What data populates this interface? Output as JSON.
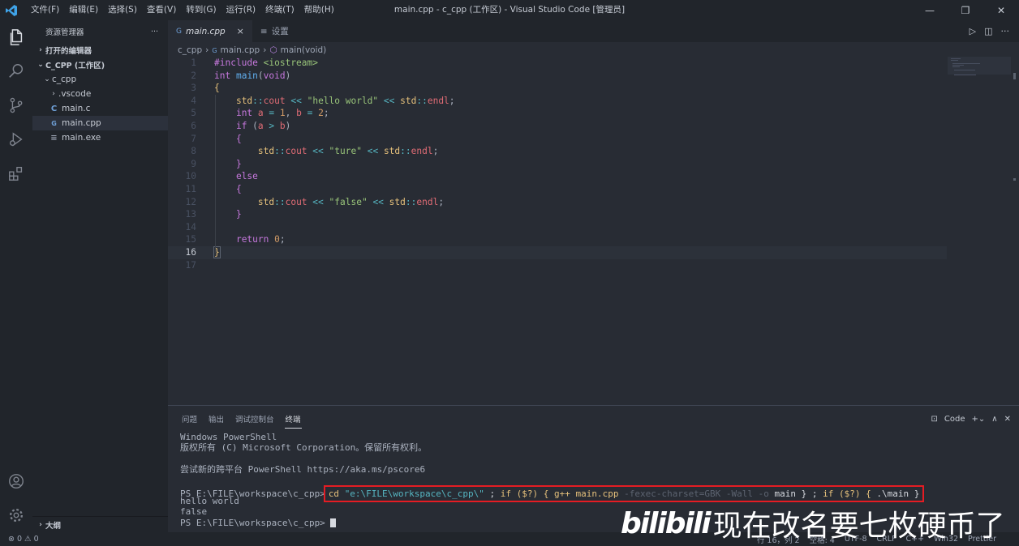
{
  "titlebar": {
    "title": "main.cpp - c_cpp (工作区) - Visual Studio Code [管理员]",
    "menu": [
      "文件(F)",
      "编辑(E)",
      "选择(S)",
      "查看(V)",
      "转到(G)",
      "运行(R)",
      "终端(T)",
      "帮助(H)"
    ]
  },
  "sidebar": {
    "header": "资源管理器",
    "more": "···",
    "open_editors": "打开的编辑器",
    "workspace": "C_CPP (工作区)",
    "folder": "c_cpp",
    "items": [
      {
        "label": ".vscode",
        "icon": "chevron-right"
      },
      {
        "label": "main.c",
        "icon": "C"
      },
      {
        "label": "main.cpp",
        "icon": "C++"
      },
      {
        "label": "main.exe",
        "icon": "file-lines"
      }
    ],
    "outline": "大纲"
  },
  "tabs": [
    {
      "label": "main.cpp",
      "close": "×"
    },
    {
      "label": "设置"
    }
  ],
  "breadcrumb": [
    "c_cpp",
    "main.cpp",
    "main(void)"
  ],
  "code": {
    "current_line": 16,
    "lines": [
      "#include <iostream>",
      "int main(void)",
      "{",
      "    std::cout << \"hello world\" << std::endl;",
      "    int a = 1, b = 2;",
      "    if (a > b)",
      "    {",
      "        std::cout << \"ture\" << std::endl;",
      "    }",
      "    else",
      "    {",
      "        std::cout << \"false\" << std::endl;",
      "    }",
      "",
      "    return 0;",
      "}",
      ""
    ]
  },
  "panel": {
    "tabs": [
      "问题",
      "输出",
      "调试控制台",
      "终端"
    ],
    "active_tab": "终端",
    "shell_label": "Code",
    "terminal": {
      "line1": "Windows PowerShell",
      "line2": "版权所有 (C) Microsoft Corporation。保留所有权利。",
      "line3": "尝试新的跨平台 PowerShell https://aka.ms/pscore6",
      "prompt": "PS E:\\FILE\\workspace\\c_cpp>",
      "cmd_cd": "cd",
      "cmd_path": "\"e:\\FILE\\workspace\\c_cpp\\\"",
      "cmd_sep1": " ; ",
      "cmd_if1": "if ($?) {",
      "cmd_gpp": "g++ main.cpp",
      "cmd_flags": "-fexec-charset=GBK -Wall -o",
      "cmd_main": "main } ; ",
      "cmd_if2": "if ($?) {",
      "cmd_run": ".\\main }",
      "out1": "hello world",
      "out2": "false",
      "prompt2": "PS E:\\FILE\\workspace\\c_cpp>"
    }
  },
  "statusbar": {
    "problems": "⊗ 0 ⚠ 0",
    "right": [
      "行 16，列 2",
      "空格: 4",
      "UTF-8",
      "CRLF",
      "C++",
      "Win32",
      "Prettier"
    ]
  },
  "watermark": {
    "logo": "bilibili",
    "text": "现在改名要七枚硬币了"
  }
}
